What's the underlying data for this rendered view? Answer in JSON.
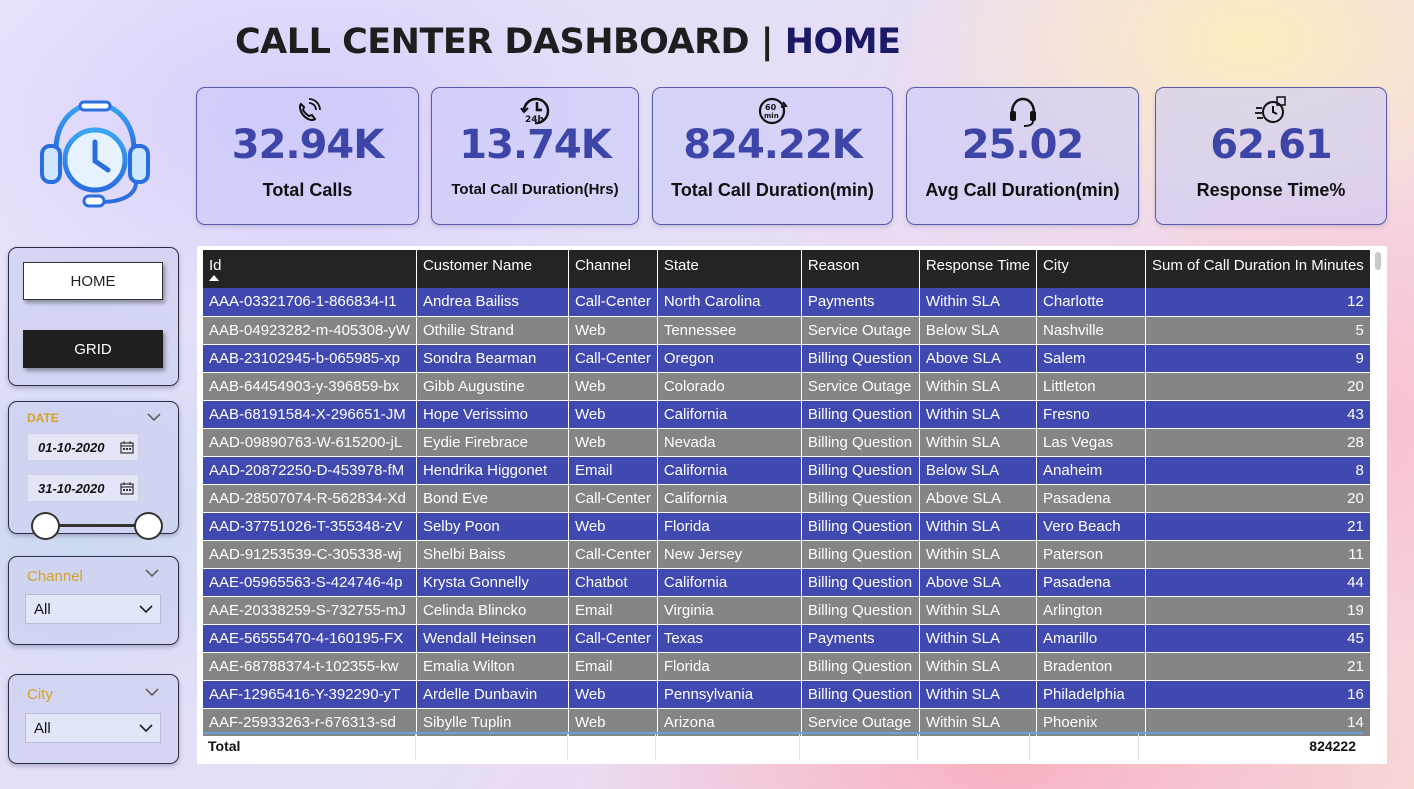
{
  "header": {
    "title_main": "CALL CENTER DASHBOARD | ",
    "title_accent": "HOME"
  },
  "logo": {
    "icon": "headset-clock-icon"
  },
  "kpis": [
    {
      "value": "32.94K",
      "label": "Total Calls",
      "icon": "phone-ring-icon"
    },
    {
      "value": "13.74K",
      "label": "Total Call Duration(Hrs)",
      "icon": "clock-24h-icon"
    },
    {
      "value": "824.22K",
      "label": "Total Call Duration(min)",
      "icon": "timer-60min-icon"
    },
    {
      "value": "25.02",
      "label": "Avg Call Duration(min)",
      "icon": "headset-icon"
    },
    {
      "value": "62.61",
      "label": "Response Time%",
      "icon": "fast-clock-icon"
    }
  ],
  "nav": {
    "home_label": "HOME",
    "grid_label": "GRID"
  },
  "date_slicer": {
    "title": "DATE",
    "start": "01-10-2020",
    "end": "31-10-2020"
  },
  "channel_slicer": {
    "title": "Channel",
    "value": "All"
  },
  "city_slicer": {
    "title": "City",
    "value": "All"
  },
  "table": {
    "columns": [
      "Id",
      "Customer Name",
      "Channel",
      "State",
      "Reason",
      "Response Time",
      "City",
      "Sum of Call Duration In Minutes"
    ],
    "rows": [
      [
        "AAA-03321706-1-866834-I1",
        "Andrea Bailiss",
        "Call-Center",
        "North Carolina",
        "Payments",
        "Within SLA",
        "Charlotte",
        "12"
      ],
      [
        "AAB-04923282-m-405308-yW",
        "Othilie Strand",
        "Web",
        "Tennessee",
        "Service Outage",
        "Below SLA",
        "Nashville",
        "5"
      ],
      [
        "AAB-23102945-b-065985-xp",
        "Sondra Bearman",
        "Call-Center",
        "Oregon",
        "Billing Question",
        "Above SLA",
        "Salem",
        "9"
      ],
      [
        "AAB-64454903-y-396859-bx",
        "Gibb Augustine",
        "Web",
        "Colorado",
        "Service Outage",
        "Within SLA",
        "Littleton",
        "20"
      ],
      [
        "AAB-68191584-X-296651-JM",
        "Hope Verissimo",
        "Web",
        "California",
        "Billing Question",
        "Within SLA",
        "Fresno",
        "43"
      ],
      [
        "AAD-09890763-W-615200-jL",
        "Eydie Firebrace",
        "Web",
        "Nevada",
        "Billing Question",
        "Within SLA",
        "Las Vegas",
        "28"
      ],
      [
        "AAD-20872250-D-453978-fM",
        "Hendrika Higgonet",
        "Email",
        "California",
        "Billing Question",
        "Below SLA",
        "Anaheim",
        "8"
      ],
      [
        "AAD-28507074-R-562834-Xd",
        "Bond Eve",
        "Call-Center",
        "California",
        "Billing Question",
        "Above SLA",
        "Pasadena",
        "20"
      ],
      [
        "AAD-37751026-T-355348-zV",
        "Selby Poon",
        "Web",
        "Florida",
        "Billing Question",
        "Within SLA",
        "Vero Beach",
        "21"
      ],
      [
        "AAD-91253539-C-305338-wj",
        "Shelbi Baiss",
        "Call-Center",
        "New Jersey",
        "Billing Question",
        "Within SLA",
        "Paterson",
        "11"
      ],
      [
        "AAE-05965563-S-424746-4p",
        "Krysta Gonnelly",
        "Chatbot",
        "California",
        "Billing Question",
        "Above SLA",
        "Pasadena",
        "44"
      ],
      [
        "AAE-20338259-S-732755-mJ",
        "Celinda Blincko",
        "Email",
        "Virginia",
        "Billing Question",
        "Within SLA",
        "Arlington",
        "19"
      ],
      [
        "AAE-56555470-4-160195-FX",
        "Wendall Heinsen",
        "Call-Center",
        "Texas",
        "Payments",
        "Within SLA",
        "Amarillo",
        "45"
      ],
      [
        "AAE-68788374-t-102355-kw",
        "Emalia Wilton",
        "Email",
        "Florida",
        "Billing Question",
        "Within SLA",
        "Bradenton",
        "21"
      ],
      [
        "AAF-12965416-Y-392290-yT",
        "Ardelle Dunbavin",
        "Web",
        "Pennsylvania",
        "Billing Question",
        "Within SLA",
        "Philadelphia",
        "16"
      ],
      [
        "AAF-25933263-r-676313-sd",
        "Sibylle Tuplin",
        "Web",
        "Arizona",
        "Service Outage",
        "Within SLA",
        "Phoenix",
        "14"
      ]
    ],
    "total_label": "Total",
    "total_value": "824222"
  },
  "colors": {
    "row_blue": "#4049b0",
    "row_gray": "#858585",
    "kpi_value": "#3d46a8",
    "slicer_title": "#d4a12a",
    "header_bg": "#252423"
  }
}
